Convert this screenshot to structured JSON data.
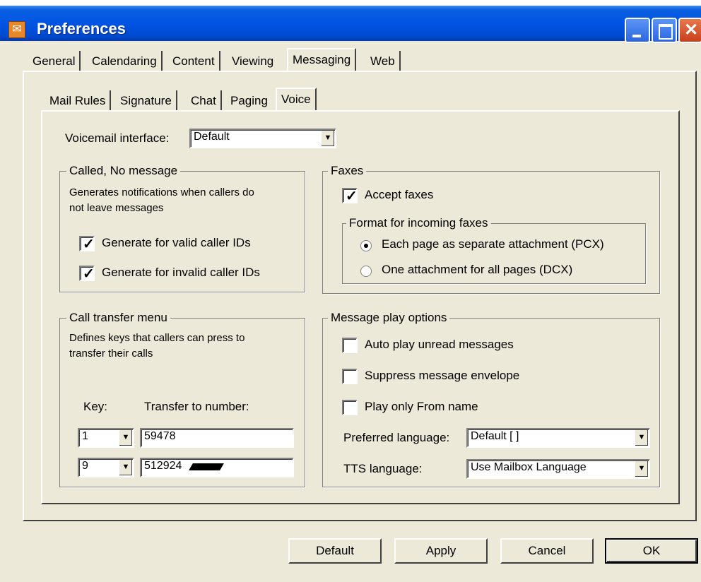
{
  "window": {
    "title": "Preferences"
  },
  "main_tabs": [
    "General",
    "Calendaring",
    "Content",
    "Viewing",
    "Messaging",
    "Web"
  ],
  "sub_tabs": [
    "Mail Rules",
    "Signature",
    "Chat",
    "Paging",
    "Voice"
  ],
  "voicemail_interface": {
    "label": "Voicemail interface:",
    "value": "Default"
  },
  "called_no_message": {
    "legend": "Called, No message",
    "description_line1": "Generates notifications when callers do",
    "description_line2": "not leave messages",
    "valid": {
      "label": "Generate for valid caller IDs",
      "checked": true
    },
    "invalid": {
      "label": "Generate for invalid caller IDs",
      "checked": true
    }
  },
  "faxes": {
    "legend": "Faxes",
    "accept": {
      "label": "Accept faxes",
      "checked": true
    },
    "format": {
      "legend": "Format for incoming faxes",
      "pcx": {
        "label": "Each page as separate attachment (PCX)",
        "selected": true
      },
      "dcx": {
        "label": "One attachment for all pages (DCX)",
        "selected": false
      }
    }
  },
  "call_transfer": {
    "legend": "Call transfer menu",
    "description_line1": "Defines keys that callers can press to",
    "description_line2": "transfer their calls",
    "key_header": "Key:",
    "number_header": "Transfer to number:",
    "rows": [
      {
        "key": "1",
        "number": "59478"
      },
      {
        "key": "9",
        "number": "512924"
      }
    ]
  },
  "message_play": {
    "legend": "Message play options",
    "auto_play": {
      "label": "Auto play unread messages",
      "checked": false
    },
    "suppress": {
      "label": "Suppress message envelope",
      "checked": false
    },
    "from_name": {
      "label": "Play only From name",
      "checked": false
    },
    "preferred_language": {
      "label": "Preferred language:",
      "value": "Default [ ]"
    },
    "tts_language": {
      "label": "TTS language:",
      "value": "Use Mailbox Language"
    }
  },
  "buttons": {
    "default": "Default",
    "apply": "Apply",
    "cancel": "Cancel",
    "ok": "OK"
  }
}
